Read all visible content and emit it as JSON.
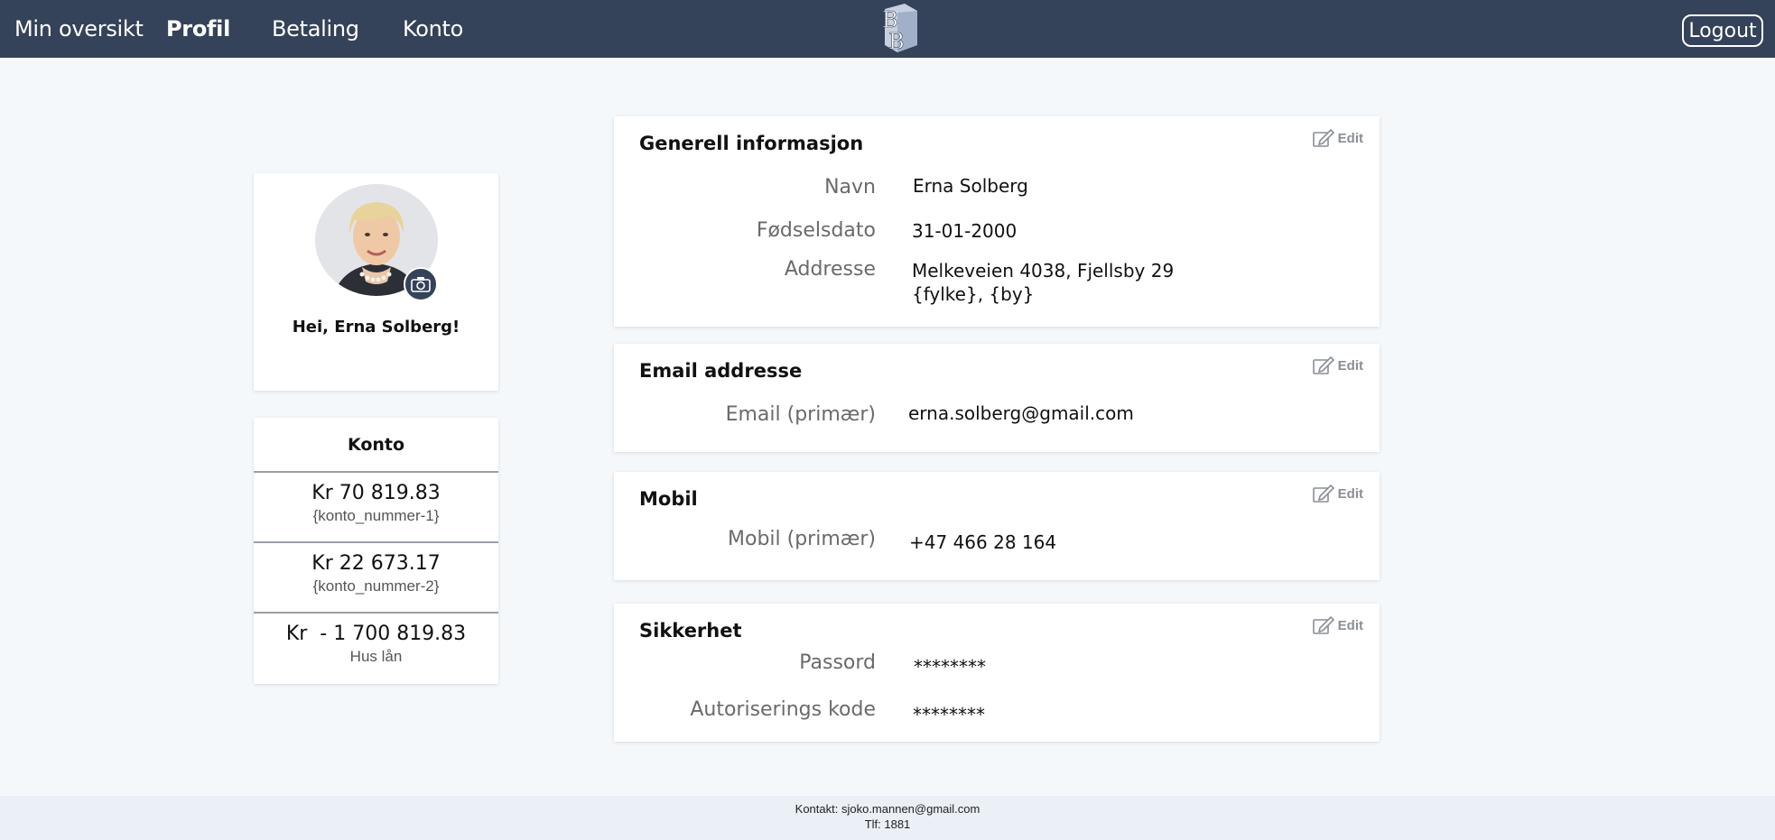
{
  "nav": {
    "items": [
      "Min oversikt",
      "Profil",
      "Betaling",
      "Konto"
    ],
    "logout_label": "Logout",
    "logo_text": "BB"
  },
  "profile": {
    "greeting": "Hei, Erna Solberg!"
  },
  "konto": {
    "title": "Konto",
    "accounts": [
      {
        "amount": "Kr 70 819.83",
        "sub": "{konto_nummer-1}"
      },
      {
        "amount": "Kr 22 673.17",
        "sub": "{konto_nummer-2}"
      },
      {
        "amount": "Kr  - 1 700 819.83",
        "sub": "Hus lån"
      }
    ]
  },
  "generell": {
    "title": "Generell informasjon",
    "edit_label": "Edit",
    "name_label": "Navn",
    "name_value": "Erna Solberg",
    "dob_label": "Fødselsdato",
    "dob_value": "31-01-2000",
    "address_label": "Addresse",
    "address_line1": "Melkeveien 4038, Fjellsby 29",
    "address_line2": "{fylke}, {by}"
  },
  "email": {
    "title": "Email addresse",
    "edit_label": "Edit",
    "label": "Email (primær)",
    "value": "erna.solberg@gmail.com"
  },
  "mobil": {
    "title": "Mobil",
    "edit_label": "Edit",
    "label": "Mobil (primær)",
    "value": "+47 466 28 164"
  },
  "sikkerhet": {
    "title": "Sikkerhet",
    "edit_label": "Edit",
    "password_label": "Passord",
    "password_value": "********",
    "auth_label": "Autoriserings kode",
    "auth_value": "********"
  },
  "footer": {
    "contact": "Kontakt: sjoko.mannen@gmail.com",
    "phone": "Tlf: 1881"
  },
  "colors": {
    "nav_bg": "#34425a",
    "page_bg": "#f5f8fb",
    "footer_bg": "#ebeff6"
  }
}
